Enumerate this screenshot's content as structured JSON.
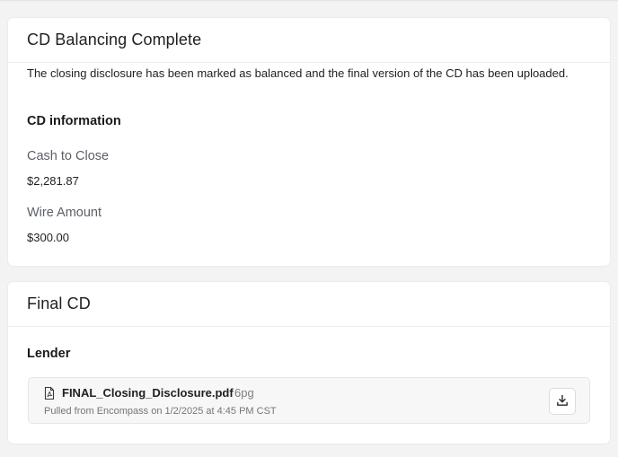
{
  "balancing_card": {
    "title": "CD Balancing Complete",
    "message": "The closing disclosure has been marked as balanced and the final version of the CD has been uploaded.",
    "section_heading": "CD information",
    "fields": [
      {
        "label": "Cash to Close",
        "value": "$2,281.87"
      },
      {
        "label": "Wire Amount",
        "value": "$300.00"
      }
    ]
  },
  "final_cd_card": {
    "title": "Final CD",
    "section_heading": "Lender",
    "file": {
      "name": "FINAL_Closing_Disclosure.pdf",
      "pages": "6pg",
      "meta": "Pulled from Encompass on 1/2/2025 at 4:45 PM CST",
      "icon": "pdf-file-icon",
      "action_icon": "download-icon"
    }
  }
}
